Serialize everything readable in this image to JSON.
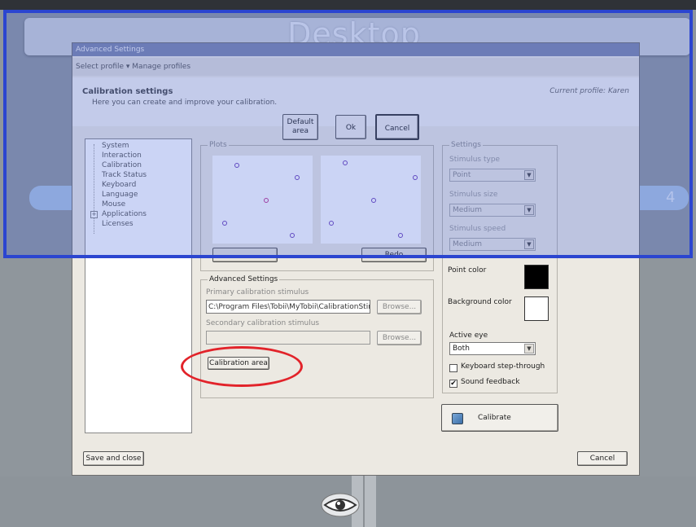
{
  "desktop": {
    "title": "Desktop",
    "strip_number": "4"
  },
  "dialog": {
    "title": "Advanced Settings",
    "menu": "Select profile  ▾  Manage profiles",
    "header": {
      "title": "Calibration settings",
      "subtitle": "Here you can create and improve your calibration.",
      "profile": "Current profile: Karen"
    },
    "top_buttons": {
      "default_area_line1": "Default",
      "default_area_line2": "area",
      "ok": "Ok",
      "cancel": "Cancel"
    },
    "tree": {
      "items": [
        "System",
        "Interaction",
        "Calibration",
        "Track Status",
        "Keyboard",
        "Language",
        "Mouse",
        "Applications",
        "Licenses"
      ],
      "expander": "+"
    },
    "plots": {
      "label": "Plots",
      "left_button": "",
      "right_button": "Redo"
    },
    "advanced": {
      "label": "Advanced Settings",
      "primary_label": "Primary calibration stimulus",
      "primary_value": "C:\\Program Files\\Tobii\\MyTobii\\CalibrationStimuli",
      "secondary_label": "Secondary calibration stimulus",
      "secondary_value": "",
      "browse": "Browse...",
      "calibration_area": "Calibration area"
    },
    "settings": {
      "label": "Settings",
      "stimulus_type_label": "Stimulus type",
      "stimulus_type_value": "Point",
      "stimulus_size_label": "Stimulus size",
      "stimulus_size_value": "Medium",
      "stimulus_speed_label": "Stimulus speed",
      "stimulus_speed_value": "Medium",
      "point_color_label": "Point color",
      "point_color": "#000000",
      "background_color_label": "Background color",
      "background_color": "#ffffff",
      "active_eye_label": "Active eye",
      "active_eye_value": "Both",
      "keyboard_step_label": "Keyboard step-through",
      "keyboard_step_checked": false,
      "sound_feedback_label": "Sound feedback",
      "sound_feedback_checked": true,
      "check_mark": "✔",
      "calibrate": "Calibrate"
    },
    "bottom": {
      "save_close": "Save and close",
      "cancel": "Cancel"
    }
  },
  "icons": {
    "dropdown_arrow": "▼"
  },
  "colors": {
    "highlight_overlay": "#2b45d0",
    "annotation_circle": "#e2232a"
  }
}
